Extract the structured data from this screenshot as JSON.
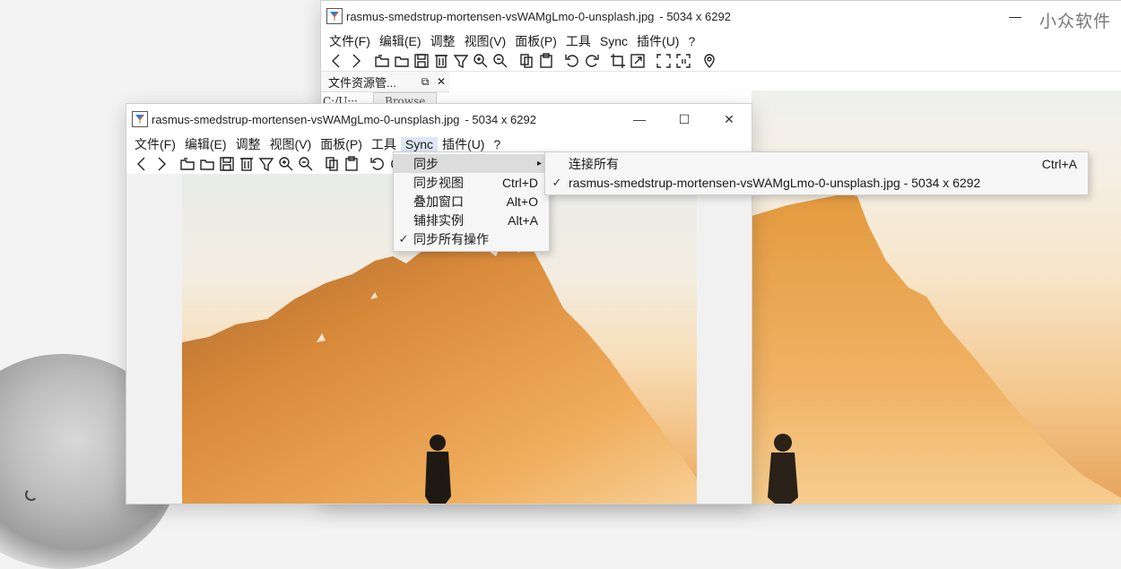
{
  "back_window": {
    "title": "rasmus-smedstrup-mortensen-vsWAMgLmo-0-unsplash.jpg",
    "dims": "- 5034 x 6292",
    "watermark": "小众软件",
    "menu": [
      "文件(F)",
      "编辑(E)",
      "调整",
      "视图(V)",
      "面板(P)",
      "工具",
      "Sync",
      "插件(U)",
      "?"
    ],
    "panel_title": "文件资源管...",
    "path_text": "C:/U···",
    "browse_label": "Browse"
  },
  "front_window": {
    "title": "rasmus-smedstrup-mortensen-vsWAMgLmo-0-unsplash.jpg",
    "dims": "- 5034 x 6292",
    "menu": [
      "文件(F)",
      "编辑(E)",
      "调整",
      "视图(V)",
      "面板(P)",
      "工具",
      "Sync",
      "插件(U)",
      "?"
    ],
    "controls": {
      "minimize": "—",
      "maximize": "☐",
      "close": "✕"
    }
  },
  "sync_menu": {
    "items": [
      {
        "label": "同步",
        "shortcut": "",
        "checked": false,
        "submenu": true
      },
      {
        "label": "同步视图",
        "shortcut": "Ctrl+D",
        "checked": false
      },
      {
        "label": "叠加窗口",
        "shortcut": "Alt+O",
        "checked": false
      },
      {
        "label": "铺排实例",
        "shortcut": "Alt+A",
        "checked": false
      },
      {
        "label": "同步所有操作",
        "shortcut": "",
        "checked": true
      }
    ]
  },
  "sync_submenu": {
    "items": [
      {
        "label": "连接所有",
        "shortcut": "Ctrl+A",
        "checked": false
      },
      {
        "label": "rasmus-smedstrup-mortensen-vsWAMgLmo-0-unsplash.jpg  - 5034 x 6292",
        "shortcut": "",
        "checked": true
      }
    ]
  },
  "colors": {
    "menu_highlight": "#dcdcdc",
    "accent": "#dde7f3"
  }
}
